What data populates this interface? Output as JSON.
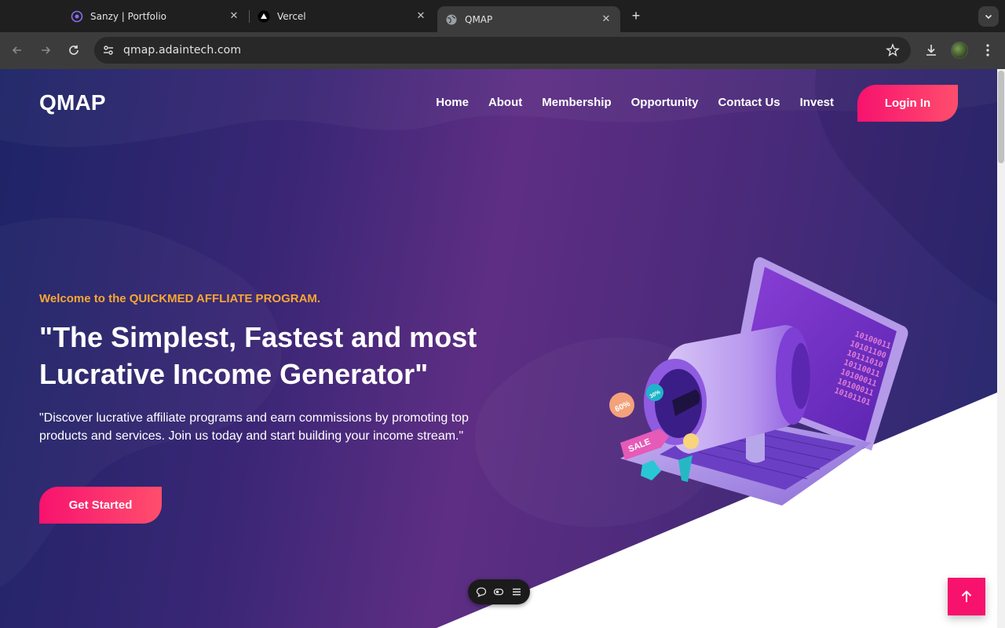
{
  "browser": {
    "tabs": [
      {
        "title": "Sanzy | Portfolio",
        "icon": "portfolio-favicon-icon",
        "active": false
      },
      {
        "title": "Vercel",
        "icon": "vercel-triangle-icon",
        "active": false
      },
      {
        "title": "QMAP",
        "icon": "globe-icon",
        "active": true
      }
    ],
    "url": "qmap.adaintech.com"
  },
  "site": {
    "logo": "QMAP",
    "nav": [
      "Home",
      "About",
      "Membership",
      "Opportunity",
      "Contact Us",
      "Invest"
    ],
    "login_label": "Login In",
    "hero": {
      "eyebrow": "Welcome to the QUICKMED AFFLIATE PROGRAM.",
      "headline": "\"The Simplest, Fastest and most Lucrative Income Generator\"",
      "description": "\"Discover lucrative affiliate programs and earn commissions by promoting top products and services. Join us today and start building your income stream.\"",
      "cta_label": "Get Started",
      "illustration": {
        "binary_lines": [
          "10100011",
          "10101100",
          "10111010",
          "10110011",
          "10100011",
          "10100011",
          "10101101"
        ],
        "badge_60": "60%",
        "badge_30": "30%",
        "sale_tag": "SALE"
      }
    }
  },
  "colors": {
    "accent_gradient_start": "#f7126e",
    "accent_gradient_end": "#ff4e6d",
    "eyebrow": "#f8a732",
    "hero_bg_dark": "#1d2466",
    "hero_bg_mid": "#5e2e84"
  }
}
